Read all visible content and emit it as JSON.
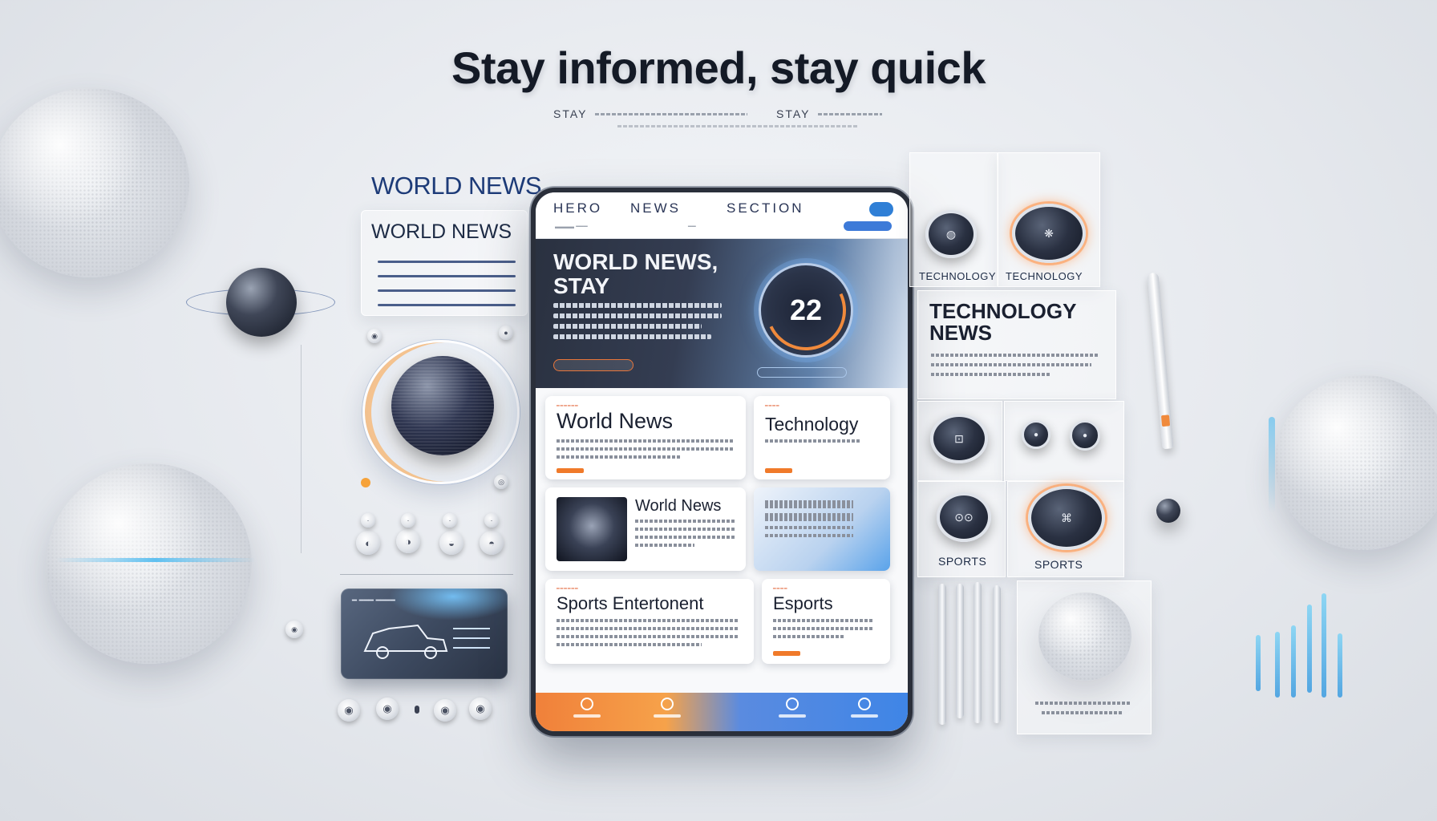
{
  "headline": "Stay informed, stay quick",
  "subline": {
    "left": "STAY",
    "right": "STAY"
  },
  "left_panel": {
    "title": "WORLD NEWS",
    "subtitle": "WORLD NEWS"
  },
  "phone": {
    "nav": {
      "hero": "HERO",
      "news": "NEWS",
      "section": "SECTION"
    },
    "hero": {
      "title": "WORLD NEWS, STAY",
      "gauge_value": "22"
    },
    "cards": {
      "world_news": "World News",
      "technology": "Technology",
      "world_news_2": "World News",
      "sports_entertainment": "Sports Entertonent",
      "esports": "Esports"
    }
  },
  "right_panel": {
    "technology_label_1": "TECHNOLOGY",
    "technology_label_2": "TECHNOLOGY",
    "technology_news": "TECHNOLOGY NEWS",
    "sports_label_1": "SPORTS",
    "sports_label_2": "SPORTS"
  },
  "icons": {
    "gauge": "gauge-icon",
    "car": "car-icon",
    "camera": "camera-icon",
    "pen": "pen-icon"
  },
  "colors": {
    "accent_orange": "#f08a3c",
    "accent_blue": "#3f85e6",
    "text_dark": "#1a2030",
    "world_news_blue": "#1d3b78"
  }
}
